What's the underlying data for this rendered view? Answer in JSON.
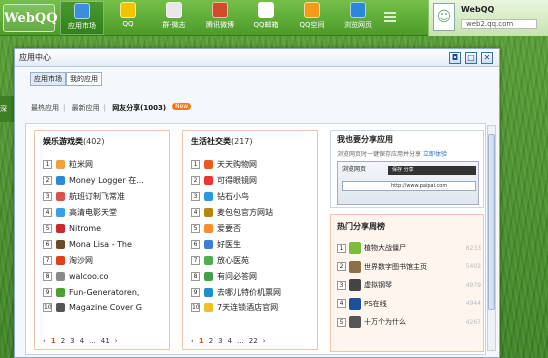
{
  "taskbar": {
    "logo": "WebQQ",
    "items": [
      {
        "label": "应用市场",
        "color": "#3b8fd8",
        "active": true
      },
      {
        "label": "QQ",
        "color": "#f2c400"
      },
      {
        "label": "群·微志",
        "color": "#e8e8e8"
      },
      {
        "label": "腾讯微博",
        "color": "#d34b2a"
      },
      {
        "label": "QQ邮箱",
        "color": "#ffffff"
      },
      {
        "label": "QQ空间",
        "color": "#f29c1a"
      },
      {
        "label": "浏览网页",
        "color": "#2b87d8"
      }
    ]
  },
  "user": {
    "name": "WebQQ",
    "url": "web2.qq.com"
  },
  "window": {
    "title": "应用中心",
    "buttons": [
      "◘",
      "□",
      "✕"
    ]
  },
  "tabs": [
    "应用市场",
    "我的应用"
  ],
  "subtabs": {
    "items": [
      "最热应用",
      "最新应用",
      "网友分享(1003)"
    ],
    "badge": "New"
  },
  "left_edge": "深",
  "panels": [
    {
      "title": "娱乐游戏类",
      "count": "(402)",
      "items": [
        {
          "n": "1",
          "name": "粒米网",
          "color": "#f0a23a"
        },
        {
          "n": "2",
          "name": "Money Logger 在...",
          "color": "#2c8bd6"
        },
        {
          "n": "3",
          "name": "航班订制飞常准",
          "color": "#d9534f"
        },
        {
          "n": "4",
          "name": "高清电影天堂",
          "color": "#3aa0e8"
        },
        {
          "n": "5",
          "name": "Nitrome",
          "color": "#cc2a2a"
        },
        {
          "n": "6",
          "name": "Mona Lisa - The",
          "color": "#6b4a2a"
        },
        {
          "n": "7",
          "name": "淘沙网",
          "color": "#e13e1a"
        },
        {
          "n": "8",
          "name": "walcoo.co",
          "color": "#8a8a8a"
        },
        {
          "n": "9",
          "name": "Fun-Generatoren,",
          "color": "#4c9f33"
        },
        {
          "n": "10",
          "name": "Magazine Cover G",
          "color": "#555555"
        }
      ],
      "pager": [
        "‹",
        "1",
        "2",
        "3",
        "4",
        "...",
        "41",
        "›"
      ]
    },
    {
      "title": "生活社交类",
      "count": "(217)",
      "items": [
        {
          "n": "1",
          "name": "天天购物网",
          "color": "#e95a1f"
        },
        {
          "n": "2",
          "name": "可得眼镜网",
          "color": "#e33"
        },
        {
          "n": "3",
          "name": "钻石小鸟",
          "color": "#2a9adf"
        },
        {
          "n": "4",
          "name": "麦包包官方网站",
          "color": "#b8860b"
        },
        {
          "n": "5",
          "name": "爱要否",
          "color": "#ff8c2a"
        },
        {
          "n": "6",
          "name": "好医生",
          "color": "#3b7dd8"
        },
        {
          "n": "7",
          "name": "放心医苑",
          "color": "#4caf50"
        },
        {
          "n": "8",
          "name": "有问必答网",
          "color": "#43a047"
        },
        {
          "n": "9",
          "name": "去哪儿特价机票网",
          "color": "#1e90c8"
        },
        {
          "n": "10",
          "name": "7天连锁酒店官网",
          "color": "#f0c020"
        }
      ],
      "pager": [
        "‹",
        "1",
        "2",
        "3",
        "4",
        "...",
        "22",
        "›"
      ]
    }
  ],
  "share": {
    "title": "我也要分享应用",
    "desc": "浏览网页时一键保存应用并分享",
    "link": "立即体验",
    "browser_title": "浏览网页",
    "address": "http://www.paipai.com",
    "dark_label": "保存 分享"
  },
  "weekly": {
    "title": "热门分享周榜",
    "items": [
      {
        "n": "1",
        "name": "植物大战僵尸",
        "count": "8233",
        "color": "#7cbd3e"
      },
      {
        "n": "2",
        "name": "世界数字图书馆主页",
        "count": "5402",
        "color": "#8b6f47"
      },
      {
        "n": "3",
        "name": "虚拟钢琴",
        "count": "4979",
        "color": "#444444"
      },
      {
        "n": "4",
        "name": "PS在线",
        "count": "4944",
        "color": "#1c4f9c"
      },
      {
        "n": "5",
        "name": "十万个为什么",
        "count": "4267",
        "color": "#555555"
      }
    ]
  }
}
